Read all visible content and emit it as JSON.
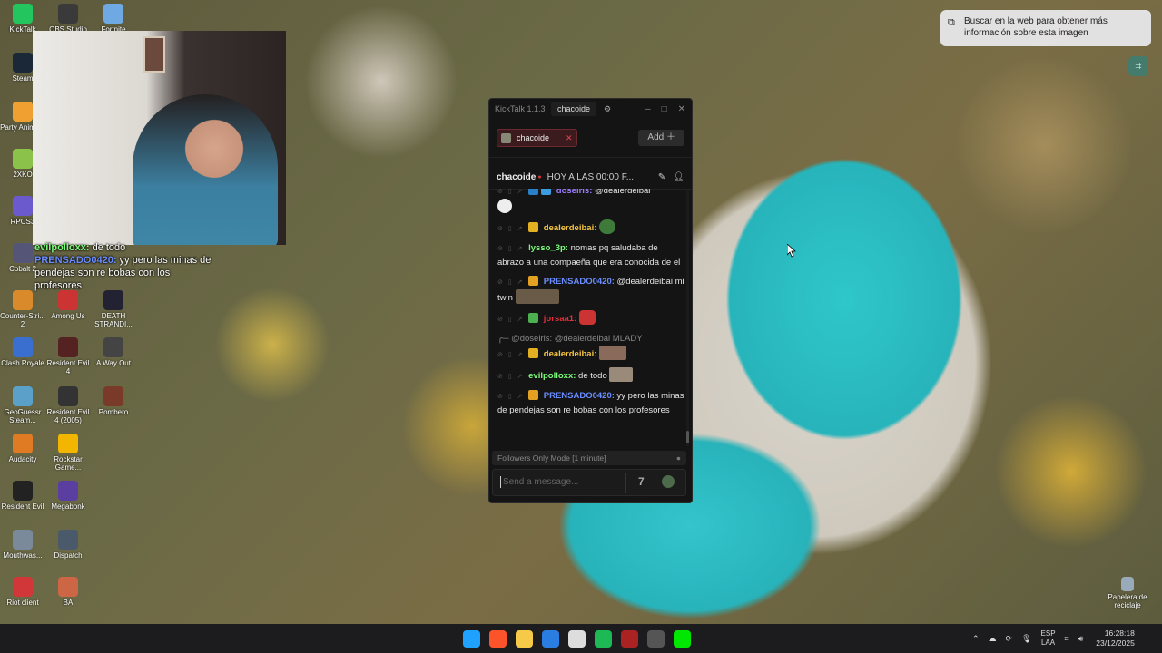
{
  "desktop": {
    "icons": [
      {
        "label": "KickTalk",
        "color": "#22c55e"
      },
      {
        "label": "OBS Studio",
        "color": "#3a3a3a"
      },
      {
        "label": "Fortnite",
        "color": "#6fa9e3"
      },
      {
        "label": "Steam",
        "color": "#1b2838"
      },
      {
        "label": "Party Anima...",
        "color": "#f0a030"
      },
      {
        "label": "2XKO",
        "color": "#8bc34a"
      },
      {
        "label": "RPCS3",
        "color": "#6a5acd"
      },
      {
        "label": "Cobalt 2",
        "color": "#557"
      },
      {
        "label": "Counter-Stri... 2",
        "color": "#d98a2a"
      },
      {
        "label": "Among Us",
        "color": "#c33"
      },
      {
        "label": "DEATH STRANDI...",
        "color": "#223"
      },
      {
        "label": "Clash Royale",
        "color": "#3a6fd0"
      },
      {
        "label": "Resident Evil 4",
        "color": "#552222"
      },
      {
        "label": "A Way Out",
        "color": "#444"
      },
      {
        "label": "GeoGuessr Steam...",
        "color": "#5aa0c8"
      },
      {
        "label": "Resident Evil 4 (2005)",
        "color": "#333"
      },
      {
        "label": "Pombero",
        "color": "#7a3a2a"
      },
      {
        "label": "Audacity",
        "color": "#e07b24"
      },
      {
        "label": "Rockstar Game...",
        "color": "#f2b600"
      },
      {
        "label": "Resident Evil",
        "color": "#222"
      },
      {
        "label": "Megabonk",
        "color": "#5b3fa0"
      },
      {
        "label": "Mouthwas...",
        "color": "#7a8a9a"
      },
      {
        "label": "Dispatch",
        "color": "#4a5a6a"
      },
      {
        "label": "Riot client",
        "color": "#d13639"
      },
      {
        "label": "BA",
        "color": "#c64"
      }
    ],
    "recycle_bin": "Papelera de reciclaje"
  },
  "stream_overlay": {
    "lines": [
      {
        "name": "evilpolloxx:",
        "text": " de todo",
        "color": "#7cfb7c"
      },
      {
        "name": "PRENSADO0420:",
        "text": " yy pero las minas de pendejas son re bobas con los profesores",
        "color": "#6a8dff"
      }
    ]
  },
  "lens_popup": {
    "text": "Buscar en la web para obtener más información sobre esta imagen"
  },
  "kicktalk": {
    "app_title": "KickTalk 1.1.3",
    "active_user": "chacoide",
    "tab_label": "chacoide",
    "add_label": "Add",
    "channel": "chacoide",
    "stream_title": "HOY A LAS 00:00 F...",
    "messages": [
      {
        "user": "doseiris:",
        "text": " @dealerdeibai",
        "color": "#9b7cff",
        "emote": true
      },
      {
        "user": "dealerdeibai:",
        "text": "",
        "color": "#f5c542",
        "emote": true
      },
      {
        "user": "lysso_3p:",
        "text": " nomas pq saludaba de abrazo a una compaeña que era conocida de el",
        "color": "#7cfb7c"
      },
      {
        "user": "PRENSADO0420:",
        "text": " @dealerdeibai mi twin",
        "color": "#6a8dff",
        "emote": true
      },
      {
        "user": "jorsaa1:",
        "text": "",
        "color": "#e0303a",
        "emote": true
      },
      {
        "reply": "@doseiris: @dealerdeibai MLADY"
      },
      {
        "user": "dealerdeibai:",
        "text": "",
        "color": "#f5c542",
        "emote": true
      },
      {
        "user": "evilpolloxx:",
        "text": " de todo",
        "color": "#7cfb7c",
        "emote": true
      },
      {
        "user": "PRENSADO0420:",
        "text": " yy pero las minas de pendejas son re bobas con los profesores",
        "color": "#6a8dff"
      }
    ],
    "followers_mode": "Followers Only Mode [1 minute]",
    "input_placeholder": "Send a message..."
  },
  "taskbar": {
    "apps": [
      "windows-start",
      "brave",
      "file-explorer",
      "bing",
      "steam",
      "spotify",
      "media",
      "obs",
      "kick"
    ],
    "app_colors": [
      "#1fa2ff",
      "#fb542b",
      "#f7c948",
      "#2a7de1",
      "#ddd",
      "#1db954",
      "#aa2222",
      "#555",
      "#00e701"
    ],
    "lang_top": "ESP",
    "lang_bottom": "LAA",
    "time": "16:28:18",
    "date": "23/12/2025"
  }
}
